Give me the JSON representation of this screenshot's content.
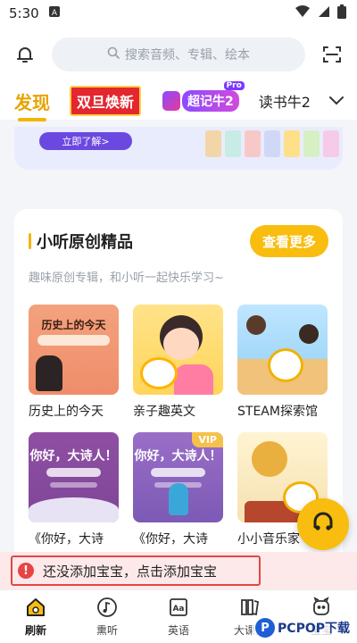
{
  "status": {
    "time": "5:30",
    "notification_icon": "a-square-icon"
  },
  "search": {
    "placeholder": "搜索音频、专辑、绘本"
  },
  "tabs": [
    {
      "label": "发现"
    },
    {
      "label": "双旦焕新"
    },
    {
      "label": "超记牛2",
      "badge": "Pro"
    },
    {
      "label": "读书牛2"
    }
  ],
  "banner": {
    "button": "立即了解>"
  },
  "section": {
    "title": "小听原创精品",
    "more": "查看更多",
    "subtitle": "趣味原创专辑，和小听一起快乐学习~",
    "cards": [
      {
        "title": "历史上的今天",
        "cover_text": "历史上的今天"
      },
      {
        "title": "亲子趣英文"
      },
      {
        "title": "STEAM探索馆"
      },
      {
        "title": "《你好，大诗",
        "cover_text": "你好，大诗人！"
      },
      {
        "title": "《你好，大诗",
        "cover_text": "你好，大诗人！",
        "badge": "VIP"
      },
      {
        "title": "小小音乐家"
      }
    ]
  },
  "toast": {
    "text": "还没添加宝宝，点击添加宝宝",
    "accent": "#e54545"
  },
  "nav": [
    {
      "label": "刷新",
      "icon": "home-icon"
    },
    {
      "label": "熏听",
      "icon": "music-note-icon"
    },
    {
      "label": "英语",
      "icon": "aa-book-icon"
    },
    {
      "label": "大课堂",
      "icon": "books-icon"
    },
    {
      "label": "宝宝",
      "icon": "baby-face-icon"
    }
  ],
  "watermark": {
    "text": "PCPOP下载"
  },
  "colors": {
    "accent": "#f8bd0f",
    "tab_active": "#e8a300"
  }
}
